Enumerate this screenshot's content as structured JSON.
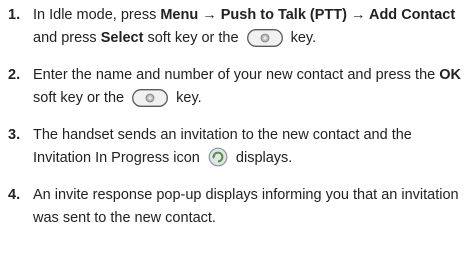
{
  "steps": [
    {
      "num": "1.",
      "t1": "In Idle mode, press ",
      "b1": "Menu → Push to Talk (PTT) → Add Contact",
      "t2": " and press ",
      "b2": "Select",
      "t3": " soft key or the ",
      "icon": "select-key-icon",
      "t4": " key."
    },
    {
      "num": "2.",
      "t1": "Enter the name and number of your new contact and press the ",
      "b1": "OK",
      "t2": " soft key or the ",
      "icon": "select-key-icon",
      "t3": " key."
    },
    {
      "num": "3.",
      "t1": "The handset sends an invitation to the new contact and the Invitation In Progress icon ",
      "icon": "invitation-in-progress-icon",
      "t2": " displays."
    },
    {
      "num": "4.",
      "t1": "An invite response pop-up displays informing you that an invitation was sent to the new contact."
    }
  ]
}
